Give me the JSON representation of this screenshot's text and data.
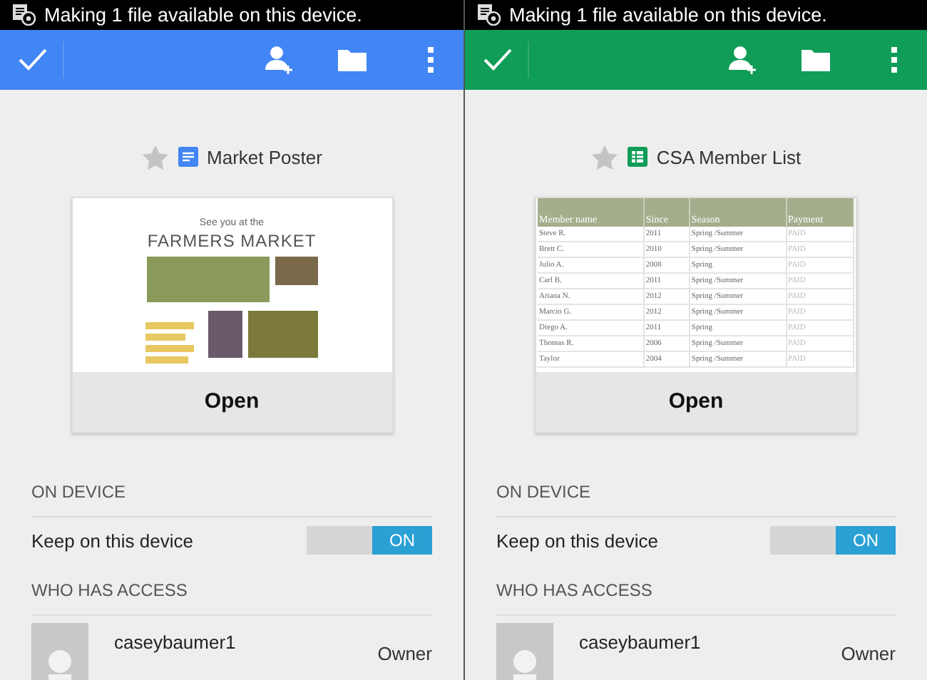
{
  "panels": [
    {
      "status_text": "Making 1 file available on this device.",
      "file": {
        "name": "Market Poster",
        "kind": "doc",
        "starred": false
      },
      "preview": {
        "kind": "poster",
        "subtitle": "See you at the",
        "title": "FARMERS MARKET"
      },
      "open_label": "Open",
      "on_device_header": "ON DEVICE",
      "keep": {
        "label": "Keep on this device",
        "on": true,
        "state_label": "ON"
      },
      "access_header": "WHO HAS ACCESS",
      "user": {
        "name": "caseybaumer1",
        "role": "Owner"
      }
    },
    {
      "status_text": "Making 1 file available on this device.",
      "file": {
        "name": "CSA Member List",
        "kind": "sheet",
        "starred": false
      },
      "preview": {
        "kind": "table",
        "columns": [
          "Member name",
          "Since",
          "Season",
          "Payment"
        ],
        "rows": [
          [
            "Steve R.",
            "2011",
            "Spring /Summer",
            "PAID"
          ],
          [
            "Brett C.",
            "2010",
            "Spring /Summer",
            "PAID"
          ],
          [
            "Julio A.",
            "2008",
            "Spring",
            "PAID"
          ],
          [
            "Carl B.",
            "2011",
            "Spring /Summer",
            "PAID"
          ],
          [
            "Ariana N.",
            "2012",
            "Spring /Summer",
            "PAID"
          ],
          [
            "Marcio G.",
            "2012",
            "Spring /Summer",
            "PAID"
          ],
          [
            "Diego A.",
            "2011",
            "Spring",
            "PAID"
          ],
          [
            "Thomas R.",
            "2006",
            "Spring /Summer",
            "PAID"
          ],
          [
            "Taylor",
            "2004",
            "Spring /Summer",
            "PAID"
          ]
        ]
      },
      "open_label": "Open",
      "on_device_header": "ON DEVICE",
      "keep": {
        "label": "Keep on this device",
        "on": true,
        "state_label": "ON"
      },
      "access_header": "WHO HAS ACCESS",
      "user": {
        "name": "caseybaumer1",
        "role": "Owner"
      }
    }
  ]
}
